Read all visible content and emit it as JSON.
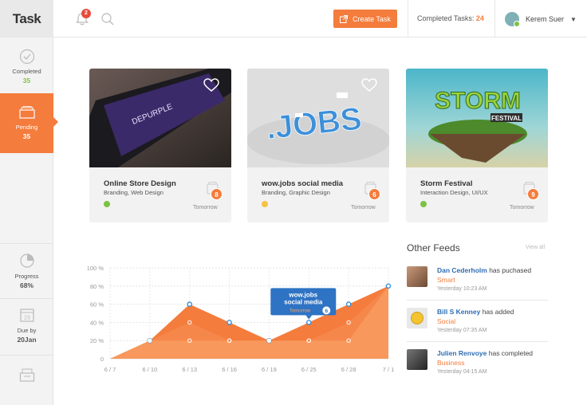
{
  "header": {
    "logo": "Task",
    "notification_count": "2",
    "create_label": "Create Task",
    "completed_label": "Completed Tasks:",
    "completed_count": "24",
    "user_name": "Kerem Suer",
    "accent": "#f47c3c"
  },
  "sidebar": {
    "items": [
      {
        "label": "Completed",
        "value": "35",
        "icon": "check-circle-icon"
      },
      {
        "label": "Pending",
        "value": "35",
        "icon": "inbox-icon"
      },
      {
        "label": "Progress",
        "value": "68%",
        "icon": "pie-icon"
      },
      {
        "label": "Due by",
        "value": "20Jan",
        "icon": "calendar-icon"
      },
      {
        "label": "",
        "value": "",
        "icon": "archive-icon"
      }
    ]
  },
  "cards": [
    {
      "title": "Online Store Design",
      "subtitle": "Branding, Web Design",
      "count": "8",
      "due": "Tomorrow",
      "dot": "#7cc243"
    },
    {
      "title": "wow.jobs social media",
      "subtitle": "Branding, Graphic Design",
      "count": "6",
      "due": "Tomorrow",
      "dot": "#f6c243"
    },
    {
      "title": "Storm Festival",
      "subtitle": "Interaction Design, UI/UX",
      "count": "9",
      "due": "Tomorrow",
      "dot": "#7cc243"
    }
  ],
  "card_images": {
    "img1_text": "DEPURPLE",
    "img2_text": ".JOBS",
    "img3_text": "STORM",
    "img3_sub": "FESTIVAL"
  },
  "chart_data": {
    "type": "area",
    "x": [
      "6 / 7",
      "6 / 10",
      "6 / 13",
      "6 / 16",
      "6 / 19",
      "6 / 25",
      "6 / 28",
      "7 / 1"
    ],
    "series": [
      {
        "values": [
          0,
          20,
          60,
          40,
          20,
          40,
          60,
          80
        ]
      },
      {
        "values": [
          0,
          20,
          40,
          20,
          20,
          20,
          40,
          80
        ]
      },
      {
        "values": [
          0,
          20,
          20,
          20,
          20,
          20,
          20,
          80
        ]
      }
    ],
    "yticks": [
      "0",
      "20 %",
      "40 %",
      "60 %",
      "80 %",
      "100 %"
    ],
    "ylim": [
      0,
      100
    ],
    "tooltip": {
      "title": "wow.jobs",
      "subtitle": "social media",
      "due": "Tomorrow",
      "count": "6"
    }
  },
  "feeds": {
    "title": "Other Feeds",
    "view_all": "View all",
    "items": [
      {
        "name": "Dan Cederholm",
        "action": "has puchased",
        "object": "Smart",
        "time": "Yesterday 10:23 AM"
      },
      {
        "name": "Bill S Kenney",
        "action": "has added",
        "object": "Social",
        "time": "Yesterday 07:35 AM"
      },
      {
        "name": "Julien Renvoye",
        "action": "has completed",
        "object": "Business",
        "time": "Yesterday 04:15 AM"
      }
    ]
  }
}
